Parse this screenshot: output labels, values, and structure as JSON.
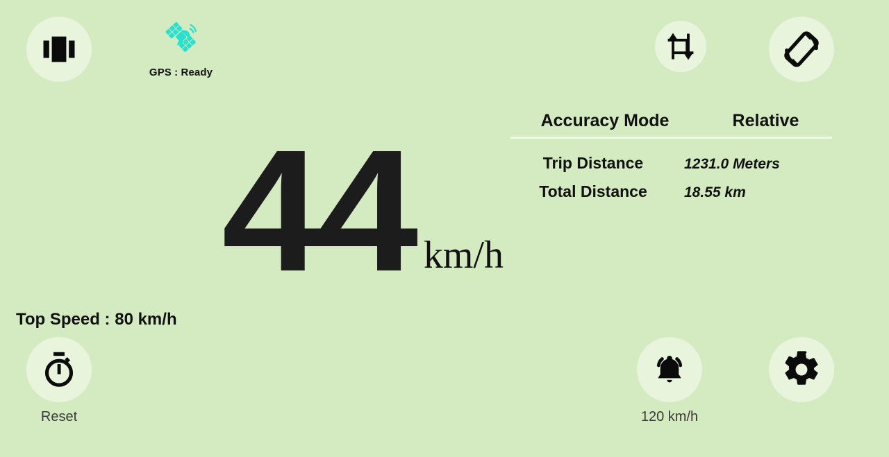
{
  "app": {
    "background_color": "#d4ebc1",
    "button_circle_color": "#e9f4dd",
    "ink_color": "#111111",
    "accent_color": "#27e0d0"
  },
  "topbar": {
    "layout_button": {
      "icon": "view-carousel-icon",
      "label": ""
    },
    "gps": {
      "icon": "satellite-icon",
      "icon_color": "#27e0d0",
      "status_text": "GPS : Ready"
    },
    "crop_button": {
      "icon": "crop-resize-icon"
    },
    "rotate_button": {
      "icon": "screen-rotation-icon"
    }
  },
  "speed": {
    "value": "44",
    "unit": "km/h"
  },
  "info": {
    "header": {
      "key": "Accuracy Mode",
      "value": "Relative"
    },
    "rows": [
      {
        "key": "Trip Distance",
        "value": "1231.0 Meters"
      },
      {
        "key": "Total Distance",
        "value": "18.55 km"
      }
    ]
  },
  "top_speed": {
    "text": "Top Speed : 80 km/h"
  },
  "reset": {
    "icon": "stopwatch-icon",
    "label": "Reset"
  },
  "alarm": {
    "icon": "alarm-bell-icon",
    "label": "120 km/h"
  },
  "settings": {
    "icon": "gear-icon"
  }
}
